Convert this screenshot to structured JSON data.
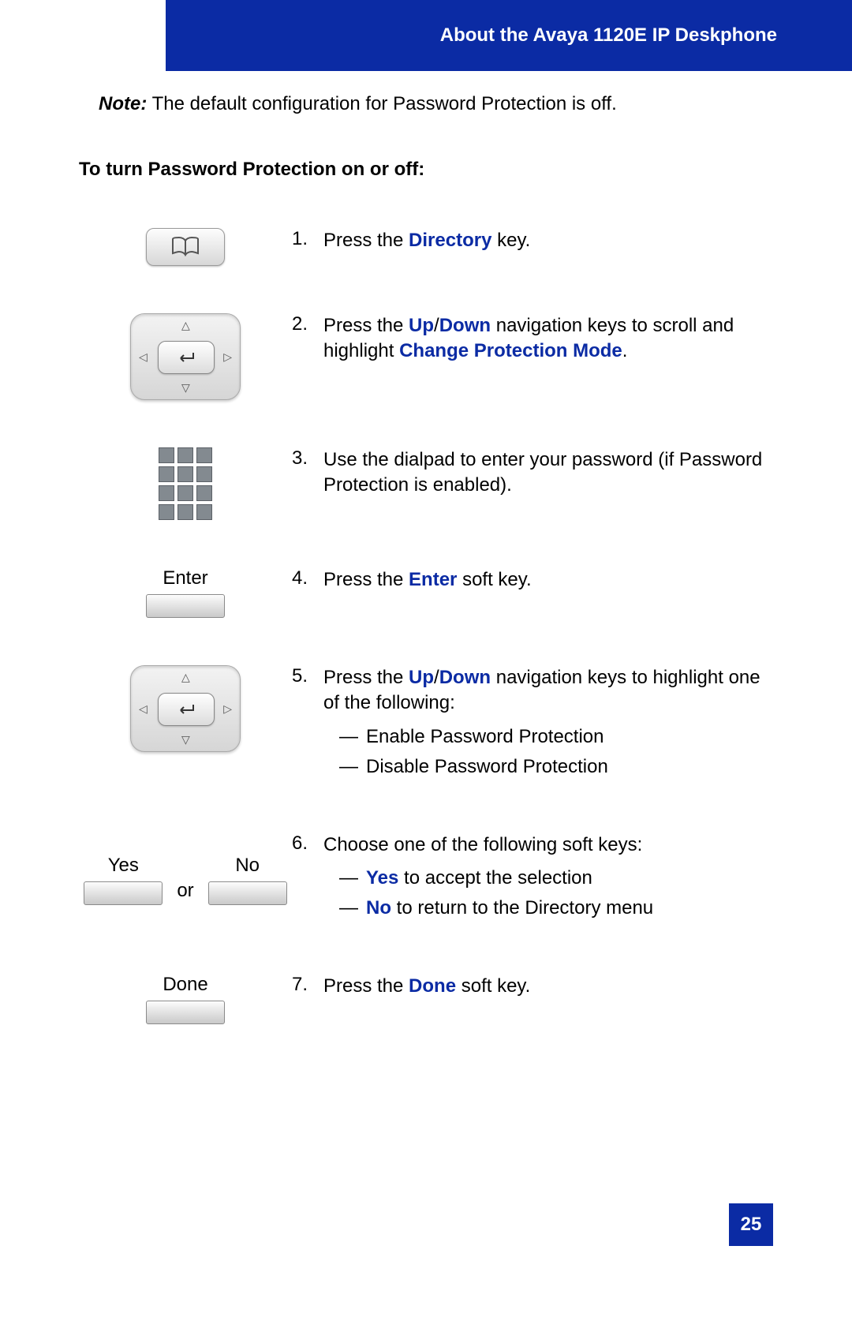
{
  "header": {
    "title": "About the Avaya 1120E IP Deskphone"
  },
  "note": {
    "label": "Note:",
    "text": " The default configuration for Password Protection is off."
  },
  "section": {
    "heading": "To turn Password Protection on or off:"
  },
  "steps": {
    "s1": {
      "num": "1.",
      "pre": "Press the ",
      "kw": "Directory",
      "post": " key."
    },
    "s2": {
      "num": "2.",
      "pre": "Press the ",
      "kw1": "Up",
      "slash": "/",
      "kw2": "Down",
      "mid": " navigation keys to scroll and highlight ",
      "kw3": "Change Protection Mode",
      "post": "."
    },
    "s3": {
      "num": "3.",
      "text": "Use the dialpad to enter your password (if Password Protection is enabled)."
    },
    "s4": {
      "num": "4.",
      "pre": "Press the ",
      "kw": "Enter",
      "post": " soft key.",
      "label": "Enter"
    },
    "s5": {
      "num": "5.",
      "pre": "Press the ",
      "kw1": "Up",
      "slash": "/",
      "kw2": "Down",
      "post": " navigation keys to highlight one of the following:",
      "opt1": "Enable Password Protection",
      "opt2": "Disable Password Protection"
    },
    "s6": {
      "num": "6.",
      "text": "Choose one of the following soft keys:",
      "yesLabel": "Yes",
      "noLabel": "No",
      "or": "or",
      "opt1kw": "Yes",
      "opt1rest": " to accept the selection",
      "opt2kw": "No",
      "opt2rest": " to return to the Directory menu"
    },
    "s7": {
      "num": "7.",
      "pre": "Press the ",
      "kw": "Done",
      "post": " soft key.",
      "label": "Done"
    }
  },
  "dash": "—",
  "page": {
    "number": "25"
  }
}
